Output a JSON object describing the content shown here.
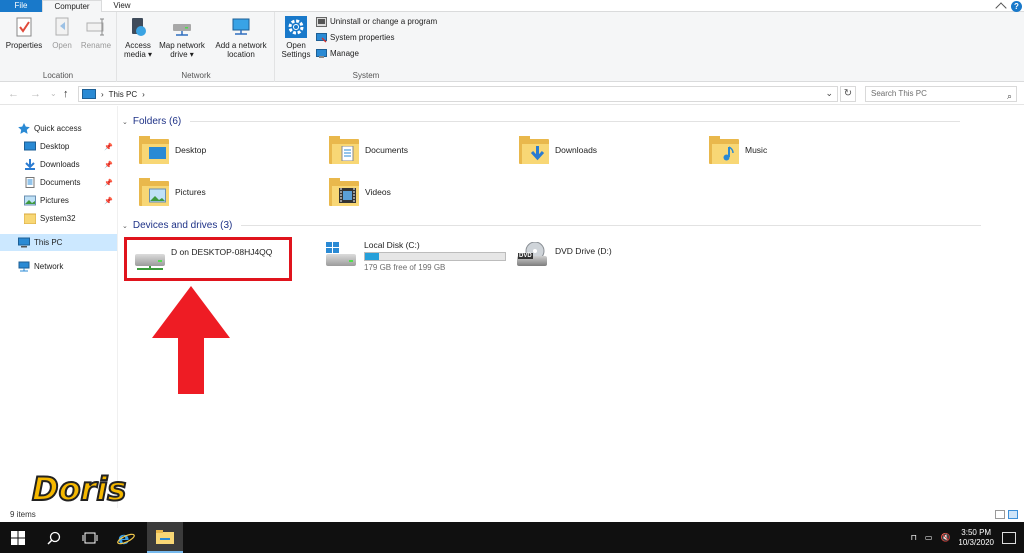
{
  "ribbon_tabs": {
    "file": "File",
    "computer": "Computer",
    "view": "View"
  },
  "ribbon": {
    "location": {
      "label": "Location",
      "properties": "Properties",
      "open": "Open",
      "rename": "Rename"
    },
    "network": {
      "label": "Network",
      "access_media": "Access media ▾",
      "map_network_drive": "Map network drive ▾",
      "add_network_location": "Add a network location"
    },
    "system": {
      "label": "System",
      "open_settings": "Open Settings",
      "uninstall": "Uninstall or change a program",
      "system_properties": "System properties",
      "manage": "Manage"
    }
  },
  "address": {
    "path": "This PC",
    "separator": "›"
  },
  "search": {
    "placeholder": "Search This PC"
  },
  "sidebar": {
    "quick_access": "Quick access",
    "items": [
      {
        "label": "Desktop"
      },
      {
        "label": "Downloads"
      },
      {
        "label": "Documents"
      },
      {
        "label": "Pictures"
      },
      {
        "label": "System32"
      }
    ],
    "this_pc": "This PC",
    "network": "Network"
  },
  "folders": {
    "header": "Folders (6)",
    "items": [
      "Desktop",
      "Documents",
      "Downloads",
      "Music",
      "Pictures",
      "Videos"
    ]
  },
  "drives": {
    "header": "Devices and drives (3)",
    "network_drive": "D on DESKTOP-08HJ4QQ",
    "local_disk": {
      "label": "Local Disk (C:)",
      "free": "179 GB free of 199 GB",
      "used_fraction": 0.1
    },
    "dvd": {
      "label": "DVD Drive (D:)",
      "badge": "DVD"
    }
  },
  "status": {
    "count": "9 items"
  },
  "watermark": "Doris",
  "taskbar": {
    "time": "3:50 PM",
    "date": "10/3/2020"
  },
  "colors": {
    "accent": "#1979ca",
    "highlight_box": "#e0141d",
    "selected": "#cce8ff"
  }
}
